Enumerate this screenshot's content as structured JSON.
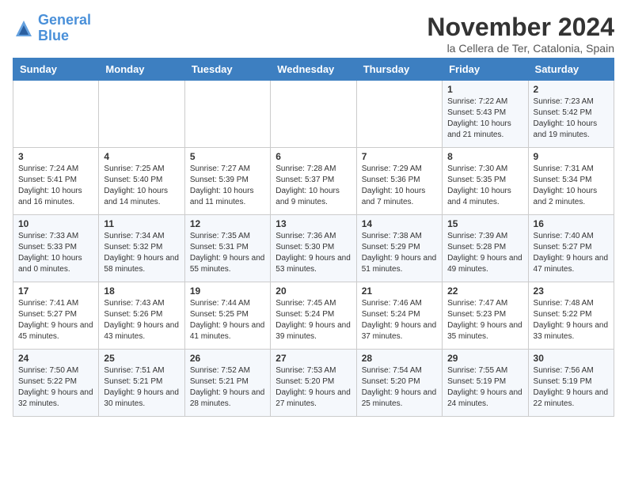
{
  "logo": {
    "line1": "General",
    "line2": "Blue"
  },
  "title": "November 2024",
  "subtitle": "la Cellera de Ter, Catalonia, Spain",
  "days_header": [
    "Sunday",
    "Monday",
    "Tuesday",
    "Wednesday",
    "Thursday",
    "Friday",
    "Saturday"
  ],
  "weeks": [
    [
      {
        "day": "",
        "info": ""
      },
      {
        "day": "",
        "info": ""
      },
      {
        "day": "",
        "info": ""
      },
      {
        "day": "",
        "info": ""
      },
      {
        "day": "",
        "info": ""
      },
      {
        "day": "1",
        "info": "Sunrise: 7:22 AM\nSunset: 5:43 PM\nDaylight: 10 hours and 21 minutes."
      },
      {
        "day": "2",
        "info": "Sunrise: 7:23 AM\nSunset: 5:42 PM\nDaylight: 10 hours and 19 minutes."
      }
    ],
    [
      {
        "day": "3",
        "info": "Sunrise: 7:24 AM\nSunset: 5:41 PM\nDaylight: 10 hours and 16 minutes."
      },
      {
        "day": "4",
        "info": "Sunrise: 7:25 AM\nSunset: 5:40 PM\nDaylight: 10 hours and 14 minutes."
      },
      {
        "day": "5",
        "info": "Sunrise: 7:27 AM\nSunset: 5:39 PM\nDaylight: 10 hours and 11 minutes."
      },
      {
        "day": "6",
        "info": "Sunrise: 7:28 AM\nSunset: 5:37 PM\nDaylight: 10 hours and 9 minutes."
      },
      {
        "day": "7",
        "info": "Sunrise: 7:29 AM\nSunset: 5:36 PM\nDaylight: 10 hours and 7 minutes."
      },
      {
        "day": "8",
        "info": "Sunrise: 7:30 AM\nSunset: 5:35 PM\nDaylight: 10 hours and 4 minutes."
      },
      {
        "day": "9",
        "info": "Sunrise: 7:31 AM\nSunset: 5:34 PM\nDaylight: 10 hours and 2 minutes."
      }
    ],
    [
      {
        "day": "10",
        "info": "Sunrise: 7:33 AM\nSunset: 5:33 PM\nDaylight: 10 hours and 0 minutes."
      },
      {
        "day": "11",
        "info": "Sunrise: 7:34 AM\nSunset: 5:32 PM\nDaylight: 9 hours and 58 minutes."
      },
      {
        "day": "12",
        "info": "Sunrise: 7:35 AM\nSunset: 5:31 PM\nDaylight: 9 hours and 55 minutes."
      },
      {
        "day": "13",
        "info": "Sunrise: 7:36 AM\nSunset: 5:30 PM\nDaylight: 9 hours and 53 minutes."
      },
      {
        "day": "14",
        "info": "Sunrise: 7:38 AM\nSunset: 5:29 PM\nDaylight: 9 hours and 51 minutes."
      },
      {
        "day": "15",
        "info": "Sunrise: 7:39 AM\nSunset: 5:28 PM\nDaylight: 9 hours and 49 minutes."
      },
      {
        "day": "16",
        "info": "Sunrise: 7:40 AM\nSunset: 5:27 PM\nDaylight: 9 hours and 47 minutes."
      }
    ],
    [
      {
        "day": "17",
        "info": "Sunrise: 7:41 AM\nSunset: 5:27 PM\nDaylight: 9 hours and 45 minutes."
      },
      {
        "day": "18",
        "info": "Sunrise: 7:43 AM\nSunset: 5:26 PM\nDaylight: 9 hours and 43 minutes."
      },
      {
        "day": "19",
        "info": "Sunrise: 7:44 AM\nSunset: 5:25 PM\nDaylight: 9 hours and 41 minutes."
      },
      {
        "day": "20",
        "info": "Sunrise: 7:45 AM\nSunset: 5:24 PM\nDaylight: 9 hours and 39 minutes."
      },
      {
        "day": "21",
        "info": "Sunrise: 7:46 AM\nSunset: 5:24 PM\nDaylight: 9 hours and 37 minutes."
      },
      {
        "day": "22",
        "info": "Sunrise: 7:47 AM\nSunset: 5:23 PM\nDaylight: 9 hours and 35 minutes."
      },
      {
        "day": "23",
        "info": "Sunrise: 7:48 AM\nSunset: 5:22 PM\nDaylight: 9 hours and 33 minutes."
      }
    ],
    [
      {
        "day": "24",
        "info": "Sunrise: 7:50 AM\nSunset: 5:22 PM\nDaylight: 9 hours and 32 minutes."
      },
      {
        "day": "25",
        "info": "Sunrise: 7:51 AM\nSunset: 5:21 PM\nDaylight: 9 hours and 30 minutes."
      },
      {
        "day": "26",
        "info": "Sunrise: 7:52 AM\nSunset: 5:21 PM\nDaylight: 9 hours and 28 minutes."
      },
      {
        "day": "27",
        "info": "Sunrise: 7:53 AM\nSunset: 5:20 PM\nDaylight: 9 hours and 27 minutes."
      },
      {
        "day": "28",
        "info": "Sunrise: 7:54 AM\nSunset: 5:20 PM\nDaylight: 9 hours and 25 minutes."
      },
      {
        "day": "29",
        "info": "Sunrise: 7:55 AM\nSunset: 5:19 PM\nDaylight: 9 hours and 24 minutes."
      },
      {
        "day": "30",
        "info": "Sunrise: 7:56 AM\nSunset: 5:19 PM\nDaylight: 9 hours and 22 minutes."
      }
    ]
  ]
}
